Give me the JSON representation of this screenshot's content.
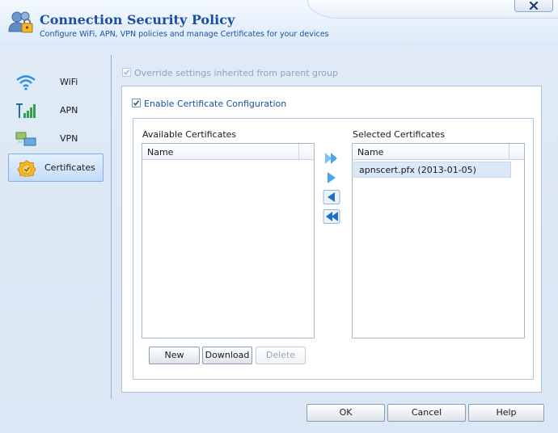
{
  "window": {
    "title": "Connection Security Policy",
    "subtitle": "Configure WiFi, APN, VPN policies and manage Certificates for your devices"
  },
  "sidebar": {
    "items": [
      {
        "label": "WiFi",
        "icon": "wifi-icon"
      },
      {
        "label": "APN",
        "icon": "signal-bars-icon"
      },
      {
        "label": "VPN",
        "icon": "vpn-icon"
      },
      {
        "label": "Certificates",
        "icon": "certificate-icon",
        "selected": true
      }
    ]
  },
  "settings": {
    "override_label": "Override settings inherited from parent group",
    "override_checked": true,
    "override_enabled": false,
    "enable_cert_label": "Enable Certificate Configuration",
    "enable_cert_checked": true
  },
  "available": {
    "title": "Available Certificates",
    "column": "Name",
    "items": []
  },
  "selected": {
    "title": "Selected Certificates",
    "column": "Name",
    "items": [
      "apnscert.pfx (2013-01-05)"
    ]
  },
  "transfer_buttons": [
    "move-all-right-icon",
    "move-right-icon",
    "move-left-icon",
    "move-all-left-icon"
  ],
  "cert_actions": {
    "new": "New",
    "download": "Download",
    "delete": "Delete"
  },
  "footer": {
    "ok": "OK",
    "cancel": "Cancel",
    "help": "Help"
  },
  "colors": {
    "accent": "#1b4fa3",
    "selection": "#dbe8f8",
    "arrow": "#2f8fe0"
  }
}
